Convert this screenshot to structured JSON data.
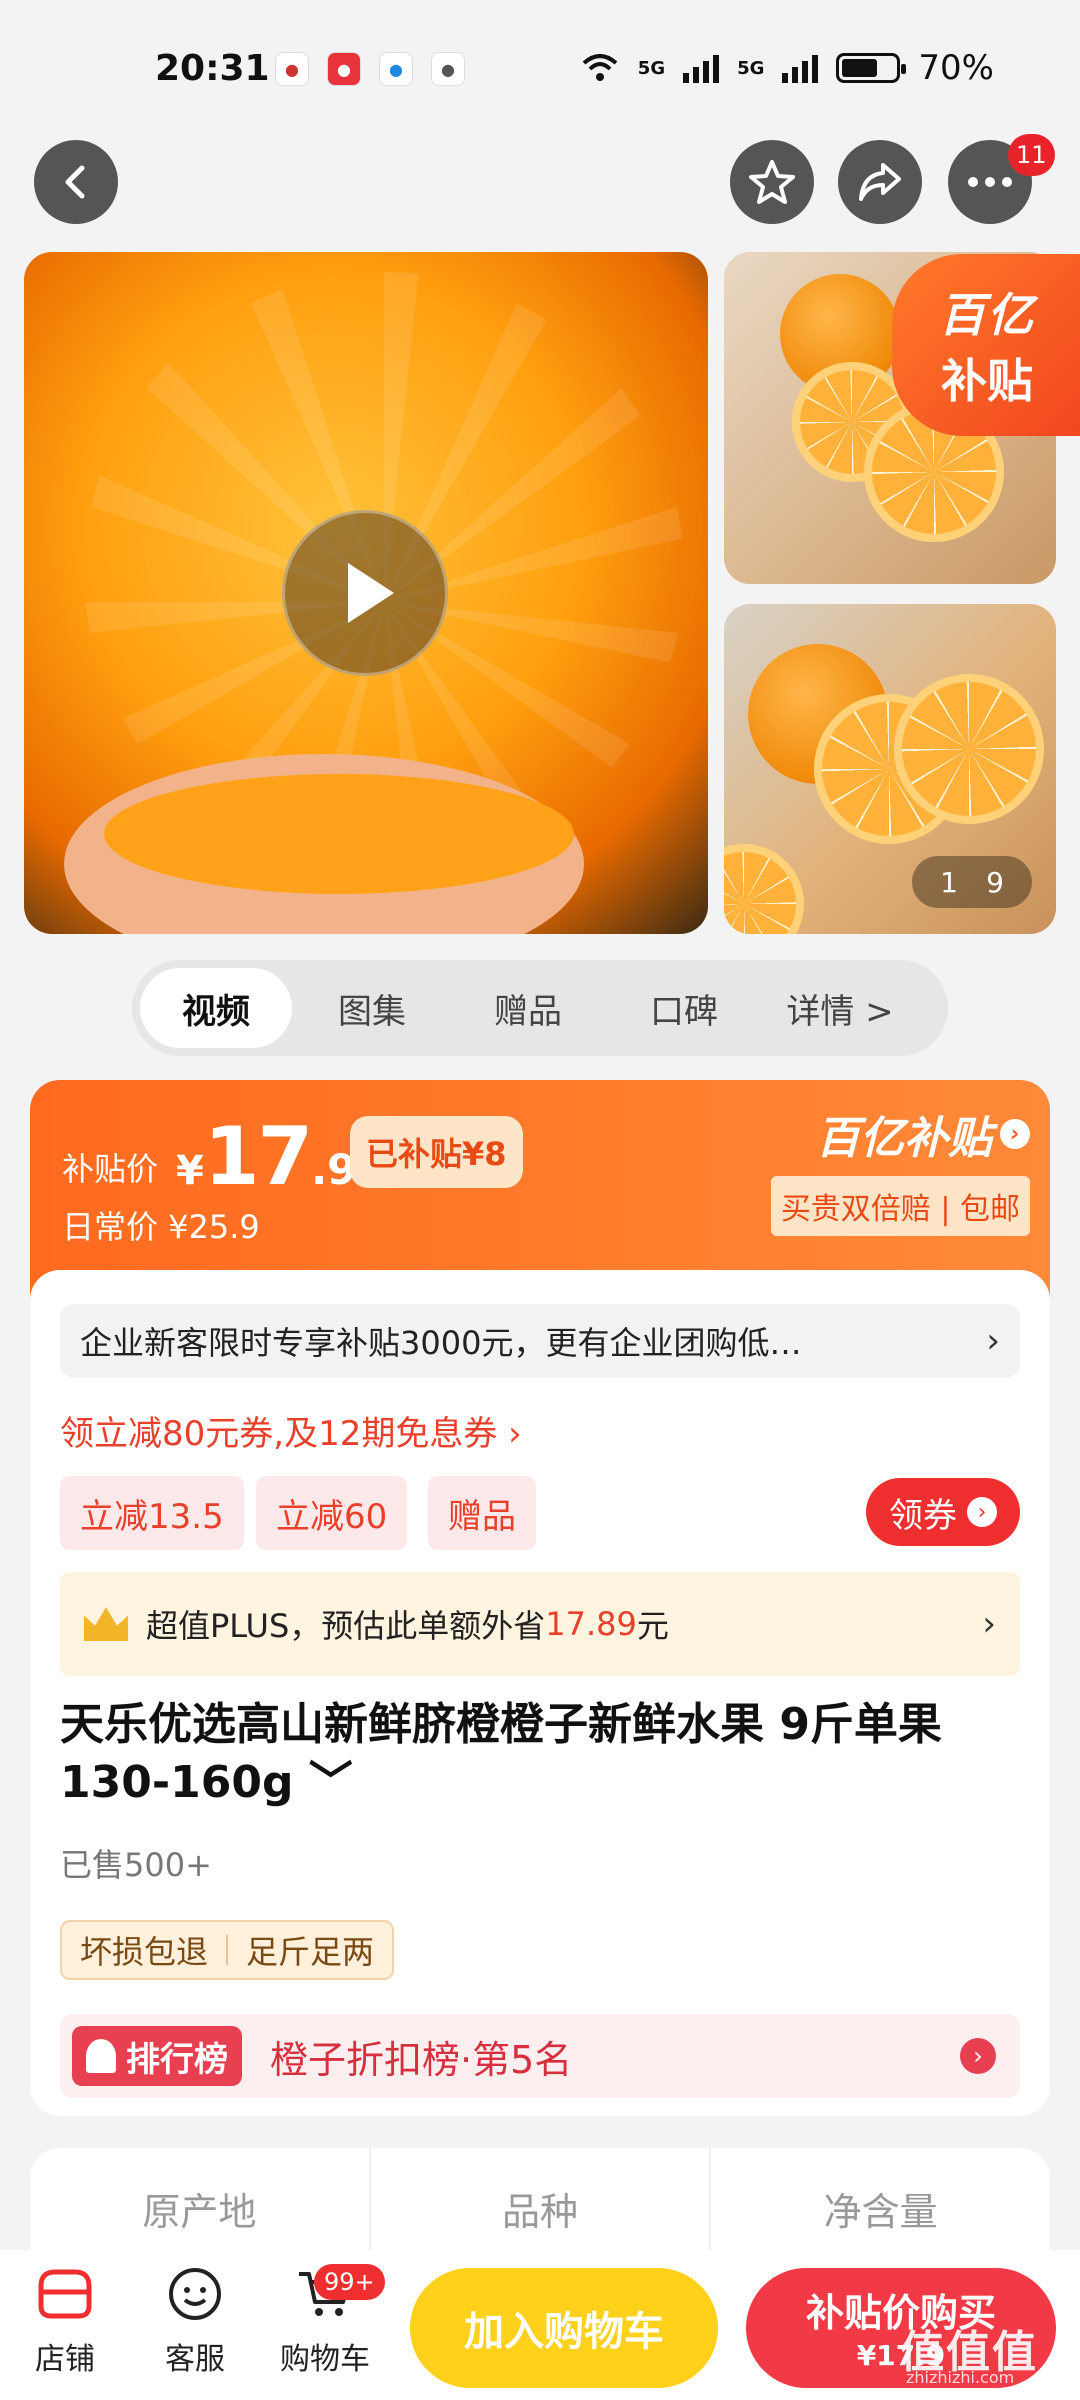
{
  "status_bar": {
    "time": "20:31",
    "battery": "70%",
    "network1": "5G",
    "network2": "5G"
  },
  "nav": {
    "badge_count": "11"
  },
  "gallery": {
    "brand_badge_line1": "百亿",
    "brand_badge_line2": "补贴",
    "page_current": "1",
    "page_total": "9"
  },
  "media_tabs": [
    "视频",
    "图集",
    "赠品",
    "口碑",
    "详情 >"
  ],
  "price": {
    "label": "补贴价",
    "currency": "¥",
    "integer": "17",
    "decimal": ".9",
    "subsidy_tag": "已补贴¥8",
    "daily": "日常价 ¥25.9",
    "brand": "百亿补贴",
    "brand_sub": "买贵双倍赔 | 包邮"
  },
  "notice": {
    "text": "企业新客限时专享补贴3000元，更有企业团购低…",
    "chevron": "›"
  },
  "coupon_link": "领立减80元券,及12期免息券 ›",
  "promos": [
    "立减13.5",
    "立减60",
    "赠品"
  ],
  "coupon_button": "领券",
  "plus": {
    "prefix": "超值PLUS，预估此单额外省",
    "amount": "17.89",
    "suffix": "元"
  },
  "product": {
    "title": "天乐优选高山新鲜脐橙橙子新鲜水果 9斤单果130-160g ﹀",
    "sold": "已售500+",
    "guarantees": [
      "坏损包退",
      "足斤足两"
    ]
  },
  "rank": {
    "tag": "排行榜",
    "text": "橙子折扣榜·第5名"
  },
  "specs": [
    "原产地",
    "品种",
    "净含量"
  ],
  "bottom_bar": {
    "store": "店铺",
    "service": "客服",
    "cart": "购物车",
    "cart_badge": "99+",
    "add_to_cart": "加入购物车",
    "buy_line1": "补贴价购买",
    "buy_line2": "¥17.9"
  },
  "watermark": {
    "main": "值值值",
    "sub": "zhizhizhi.com"
  },
  "colors": {
    "accent": "#ff6a1f",
    "red": "#ef2f2f",
    "yellow": "#ffd11a"
  }
}
